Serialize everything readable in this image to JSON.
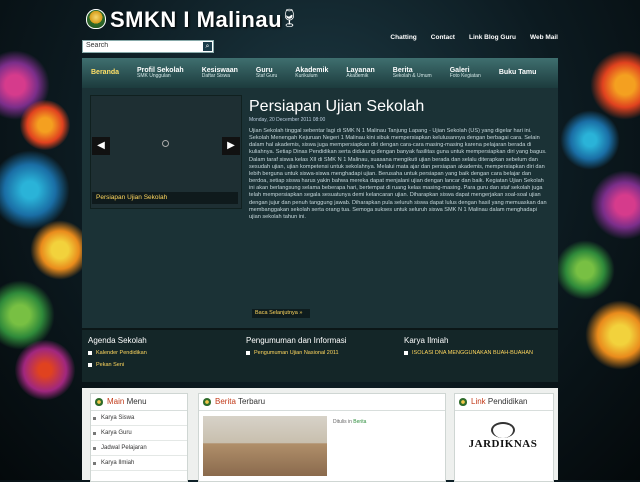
{
  "header": {
    "site_title": "SMKN I Malinau",
    "search_value": "Search",
    "top_links": [
      "Chatting",
      "Contact",
      "Link Blog Guru",
      "Web Mail"
    ]
  },
  "nav": [
    {
      "main": "Beranda",
      "sub": ""
    },
    {
      "main": "Profil Sekolah",
      "sub": "SMK Unggulan"
    },
    {
      "main": "Kesiswaan",
      "sub": "Daftar Siswa"
    },
    {
      "main": "Guru",
      "sub": "Staf Guru"
    },
    {
      "main": "Akademik",
      "sub": "Kurikulum"
    },
    {
      "main": "Layanan",
      "sub": "Akademik"
    },
    {
      "main": "Berita",
      "sub": "Sekolah & Umum"
    },
    {
      "main": "Galeri",
      "sub": "Foto Kegiatan"
    },
    {
      "main": "Buku Tamu",
      "sub": ""
    }
  ],
  "featured": {
    "slider_caption": "Persiapan Ujian Sekolah",
    "title": "Persiapan Ujian Sekolah",
    "date": "Monday, 20 December 2011 08:00",
    "body": "Ujian Sekolah tinggal sebentar lagi di SMK N 1 Malinau Tanjung Lapang - Ujian Sekolah (US) yang digelar hari ini. Sekolah Menengah Kejuruan Negeri 1 Malinau kini sibuk mempersiapkan kelulusannya dengan berbagai cara. Selain dalam hal akademis, siswa juga mempersiapkan diri dengan cara-cara masing-masing karena pelajaran berada di kuliahnya. Setiap Dinas Pendidikan serta didukung dengan banyak fasilitas guna untuk mempersiapkan diri yang bagus. Dalam taraf siswa kelas XII di SMK N 1 Malinau, suasana mengikuti ujian berada dan selalu diterapkan sebelum dan sesudah ujian, ujian kompetensi untuk sekolahnya. Melalui mata ajar dan persiapan akademis, mempersiapkan diri dan lebih berguna untuk siswa-siswa menghadapi ujian. Berusaha untuk persiapan yang baik dengan cara belajar dan berdoa, setiap siswa harus yakin bahwa mereka dapat menjalani ujian dengan lancar dan baik. Kegiatan Ujian Sekolah ini akan berlangsung selama beberapa hari, bertempat di ruang kelas masing-masing. Para guru dan staf sekolah juga telah mempersiapkan segala sesuatunya demi kelancaran ujian. Diharapkan siswa dapat mengerjakan soal-soal ujian dengan jujur dan penuh tanggung jawab. Diharapkan pula seluruh siswa dapat lulus dengan hasil yang memuaskan dan membanggakan sekolah serta orang tua. Semoga sukses untuk seluruh siswa SMK N 1 Malinau dalam menghadapi ujian sekolah tahun ini.",
    "read_more": "Baca Selanjutnya »"
  },
  "info": {
    "agenda": {
      "title": "Agenda Sekolah",
      "items": [
        "Kalender Pendidikan",
        "Pekan Seni"
      ]
    },
    "pengumuman": {
      "title": "Pengumuman dan Informasi",
      "items": [
        "Pengumuman Ujian Nasional 2011"
      ]
    },
    "karya": {
      "title": "Karya Ilmiah",
      "items": [
        "ISOLASI DNA MENGGUNAKAN BUAH-BUAHAN"
      ]
    }
  },
  "panels": {
    "main_menu": {
      "title_hl": "Main",
      "title_rest": " Menu",
      "items": [
        "Karya Siswa",
        "Karya Guru",
        "Jadwal Pelajaran",
        "Karya Ilmiah"
      ]
    },
    "berita": {
      "title_hl": "Berita",
      "title_rest": " Terbaru",
      "meta_prefix": "Ditulis in ",
      "meta_cat": "Berita"
    },
    "link": {
      "title_hl": "Link",
      "title_rest": " Pendidikan",
      "logo_text": "JARDIKNAS"
    }
  }
}
